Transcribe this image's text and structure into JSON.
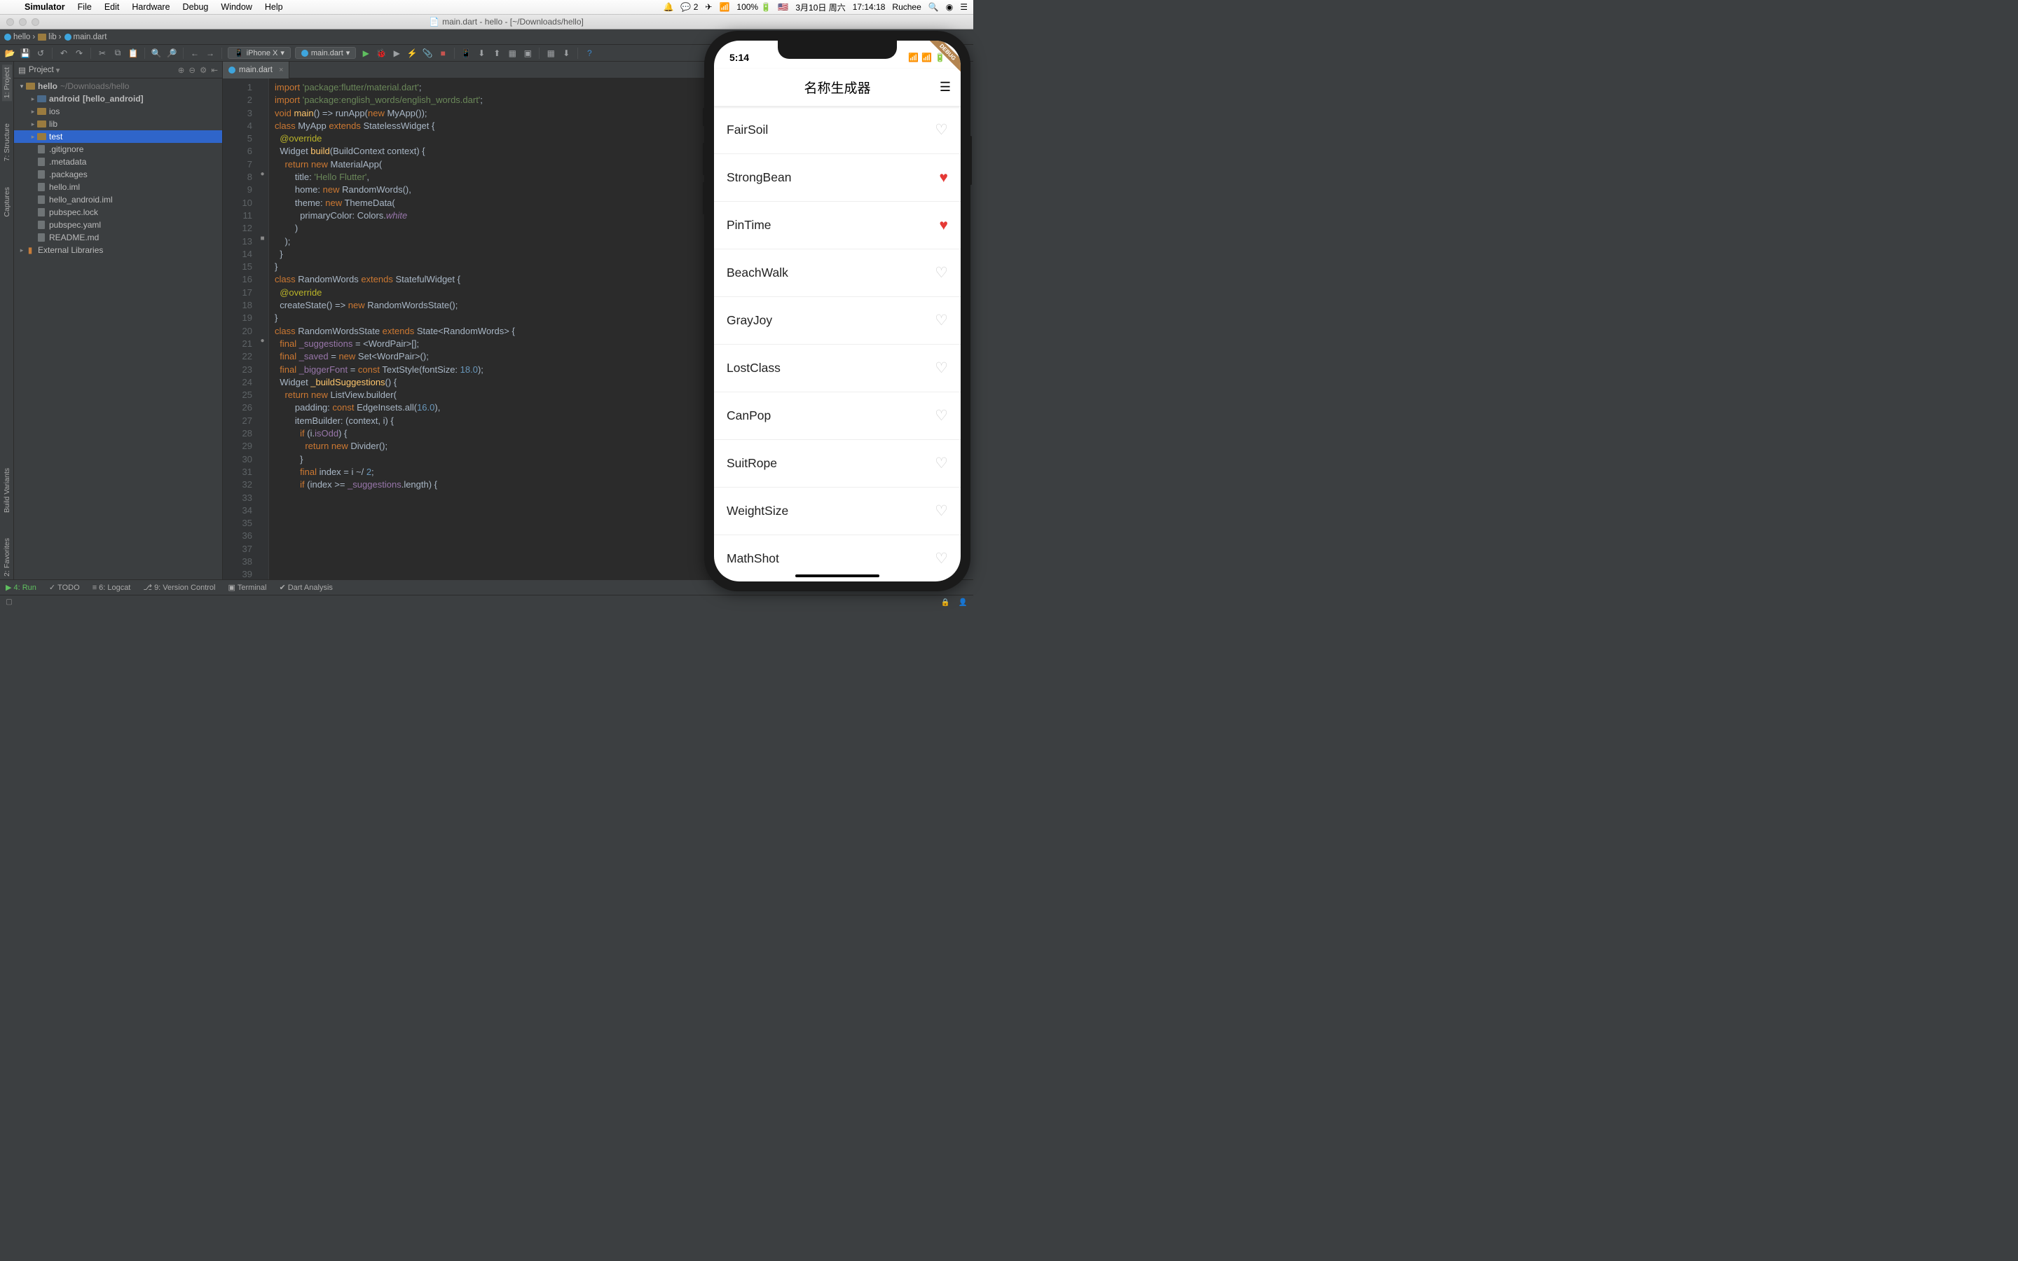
{
  "menubar": {
    "apple": "",
    "items": [
      "Simulator",
      "File",
      "Edit",
      "Hardware",
      "Debug",
      "Window",
      "Help"
    ],
    "status": {
      "qq": "",
      "wechat": "2",
      "plane": "",
      "wifi": "",
      "battery": "100%",
      "batteryicon": "",
      "flag": "🇺🇸",
      "date": "3月10日 周六",
      "time": "17:14:18",
      "user": "Ruchee",
      "search": "",
      "siri": "",
      "list": ""
    }
  },
  "window": {
    "title": "main.dart - hello - [~/Downloads/hello]"
  },
  "breadcrumb": [
    "hello",
    "lib",
    "main.dart"
  ],
  "toolbar": {
    "device": "iPhone X",
    "file": "main.dart"
  },
  "project": {
    "head": "Project",
    "root": {
      "name": "hello",
      "path": "~/Downloads/hello"
    },
    "nodes": [
      {
        "indent": 1,
        "arrow": "▸",
        "type": "fold mod",
        "label": "android",
        "extra": "[hello_android]",
        "bold": true
      },
      {
        "indent": 1,
        "arrow": "▸",
        "type": "fold",
        "label": "ios"
      },
      {
        "indent": 1,
        "arrow": "▸",
        "type": "fold",
        "label": "lib"
      },
      {
        "indent": 1,
        "arrow": "▸",
        "type": "fold",
        "label": "test",
        "sel": true
      },
      {
        "indent": 1,
        "arrow": "",
        "type": "file",
        "label": ".gitignore"
      },
      {
        "indent": 1,
        "arrow": "",
        "type": "file",
        "label": ".metadata"
      },
      {
        "indent": 1,
        "arrow": "",
        "type": "file",
        "label": ".packages"
      },
      {
        "indent": 1,
        "arrow": "",
        "type": "file",
        "label": "hello.iml"
      },
      {
        "indent": 1,
        "arrow": "",
        "type": "file",
        "label": "hello_android.iml"
      },
      {
        "indent": 1,
        "arrow": "",
        "type": "file",
        "label": "pubspec.lock"
      },
      {
        "indent": 1,
        "arrow": "",
        "type": "file yml",
        "label": "pubspec.yaml"
      },
      {
        "indent": 1,
        "arrow": "",
        "type": "file",
        "label": "README.md"
      }
    ],
    "extlib": "External Libraries"
  },
  "editor": {
    "tab": "main.dart",
    "lines": [
      {
        "n": 1,
        "html": "<span class='kw'>import </span><span class='str'>'package:flutter/material.dart'</span>;"
      },
      {
        "n": 2,
        "html": "<span class='kw'>import </span><span class='str'>'package:english_words/english_words.dart'</span>;"
      },
      {
        "n": 3,
        "html": ""
      },
      {
        "n": 4,
        "html": "<span class='kw'>void </span><span class='fn'>main</span>() =&gt; runApp(<span class='kw'>new </span>MyApp());"
      },
      {
        "n": 5,
        "html": ""
      },
      {
        "n": 6,
        "html": "<span class='kw'>class </span>MyApp <span class='kw'>extends </span>StatelessWidget {"
      },
      {
        "n": 7,
        "html": "  <span class='ann'>@override</span>"
      },
      {
        "n": 8,
        "html": "  Widget <span class='fn'>build</span>(BuildContext context) {",
        "glyph": "●"
      },
      {
        "n": 9,
        "html": "    <span class='kw'>return new </span>MaterialApp("
      },
      {
        "n": 10,
        "html": "        title: <span class='str'>'Hello Flutter'</span>,"
      },
      {
        "n": 11,
        "html": "        home: <span class='kw'>new </span>RandomWords(),"
      },
      {
        "n": 12,
        "html": "        theme: <span class='kw'>new </span>ThemeData("
      },
      {
        "n": 13,
        "html": "          primaryColor: Colors.<span class='it'>white</span>",
        "glyph": "■"
      },
      {
        "n": 14,
        "html": "        )"
      },
      {
        "n": 15,
        "html": "    );"
      },
      {
        "n": 16,
        "html": "  }"
      },
      {
        "n": 17,
        "html": "}"
      },
      {
        "n": 18,
        "html": ""
      },
      {
        "n": 19,
        "html": "<span class='kw'>class </span>RandomWords <span class='kw'>extends </span>StatefulWidget {"
      },
      {
        "n": 20,
        "html": "  <span class='ann'>@override</span>"
      },
      {
        "n": 21,
        "html": "  createState() =&gt; <span class='kw'>new </span>RandomWordsState();",
        "glyph": "●"
      },
      {
        "n": 22,
        "html": "}"
      },
      {
        "n": 23,
        "html": ""
      },
      {
        "n": 24,
        "html": "<span class='kw'>class </span>RandomWordsState <span class='kw'>extends </span>State&lt;RandomWords&gt; {"
      },
      {
        "n": 25,
        "html": "  <span class='kw'>final </span><span class='prop'>_suggestions</span> = &lt;WordPair&gt;[];"
      },
      {
        "n": 26,
        "html": "  <span class='kw'>final </span><span class='prop'>_saved</span> = <span class='kw'>new </span>Set&lt;WordPair&gt;();"
      },
      {
        "n": 27,
        "html": "  <span class='kw'>final </span><span class='prop'>_biggerFont</span> = <span class='kw'>const </span>TextStyle(fontSize: <span class='num'>18.0</span>);"
      },
      {
        "n": 28,
        "html": ""
      },
      {
        "n": 29,
        "html": "  Widget <span class='fn'>_buildSuggestions</span>() {"
      },
      {
        "n": 30,
        "html": "    <span class='kw'>return new </span>ListView.builder("
      },
      {
        "n": 31,
        "html": "        padding: <span class='kw'>const </span>EdgeInsets.all(<span class='num'>16.0</span>),"
      },
      {
        "n": 32,
        "html": "        itemBuilder: (context, i) {"
      },
      {
        "n": 33,
        "html": "          <span class='kw'>if </span>(i.<span class='prop'>isOdd</span>) {"
      },
      {
        "n": 34,
        "html": "            <span class='kw'>return new </span>Divider();"
      },
      {
        "n": 35,
        "html": "          }"
      },
      {
        "n": 36,
        "html": ""
      },
      {
        "n": 37,
        "html": "          <span class='kw'>final </span>index = i ~/ <span class='num'>2</span>;"
      },
      {
        "n": 38,
        "html": ""
      },
      {
        "n": 39,
        "html": "          <span class='kw'>if </span>(index &gt;= <span class='prop'>_suggestions</span>.length) {"
      }
    ]
  },
  "leftpanel": {
    "tabs": [
      "1: Project",
      "7: Structure",
      "Captures"
    ],
    "bottom": [
      "Build Variants",
      "2: Favorites"
    ]
  },
  "bottombar": {
    "items": [
      "4: Run",
      "TODO",
      "6: Logcat",
      "9: Version Control",
      "Terminal",
      "Dart Analysis"
    ]
  },
  "statusbar": {
    "left": "",
    "right": ""
  },
  "sim": {
    "time": "5:14",
    "title": "名称生成器",
    "badge": "DEBUG",
    "items": [
      {
        "word": "FairSoil",
        "fav": false
      },
      {
        "word": "StrongBean",
        "fav": true
      },
      {
        "word": "PinTime",
        "fav": true
      },
      {
        "word": "BeachWalk",
        "fav": false
      },
      {
        "word": "GrayJoy",
        "fav": false
      },
      {
        "word": "LostClass",
        "fav": false
      },
      {
        "word": "CanPop",
        "fav": false
      },
      {
        "word": "SuitRope",
        "fav": false
      },
      {
        "word": "WeightSize",
        "fav": false
      },
      {
        "word": "MathShot",
        "fav": false
      }
    ]
  }
}
